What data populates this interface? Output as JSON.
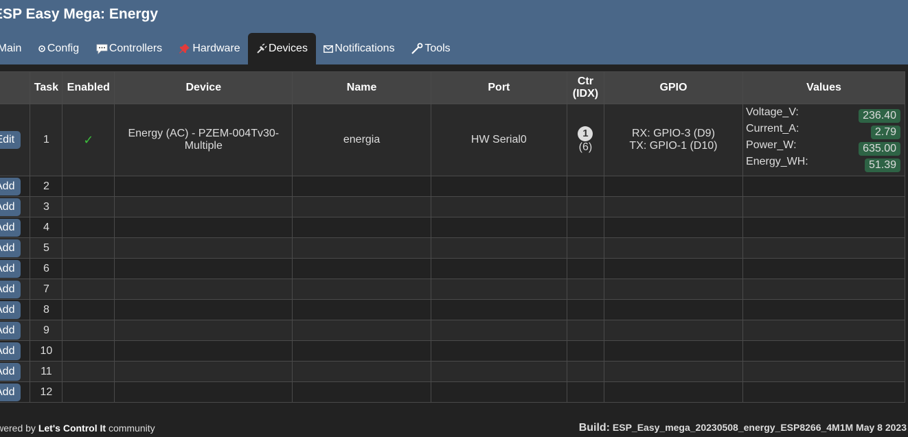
{
  "app": {
    "title": "ESP Easy Mega: Energy"
  },
  "menu": {
    "items": [
      {
        "id": "main",
        "label": "Main",
        "icon": "main-icon"
      },
      {
        "id": "config",
        "label": "Config",
        "icon": "gear-icon"
      },
      {
        "id": "controllers",
        "label": "Controllers",
        "icon": "speech-bubble-icon"
      },
      {
        "id": "hardware",
        "label": "Hardware",
        "icon": "pushpin-icon"
      },
      {
        "id": "devices",
        "label": "Devices",
        "icon": "plug-icon",
        "active": true
      },
      {
        "id": "notifications",
        "label": "Notifications",
        "icon": "envelope-icon"
      },
      {
        "id": "tools",
        "label": "Tools",
        "icon": "wrench-icon"
      }
    ]
  },
  "table": {
    "headers": [
      "",
      "Task",
      "Enabled",
      "Device",
      "Name",
      "Port",
      "Ctr (IDX)",
      "GPIO",
      "Values"
    ],
    "header_ctr_line1": "Ctr",
    "header_ctr_line2": "(IDX)",
    "first_row": {
      "button_label": "Edit",
      "task": "1",
      "enabled_mark": "✓",
      "device": "Energy (AC) - PZEM-004Tv30-Multiple",
      "name": "energia",
      "port": "HW Serial0",
      "ctr_number": "1",
      "ctr_idx": "(6)",
      "gpio_rx": "RX: GPIO-3 (D9)",
      "gpio_tx": "TX: GPIO-1 (D10)",
      "values": [
        {
          "name": "Voltage_V:",
          "value": "236.40"
        },
        {
          "name": "Current_A:",
          "value": "2.79"
        },
        {
          "name": "Power_W:",
          "value": "635.00"
        },
        {
          "name": "Energy_WH:",
          "value": "51.39"
        }
      ]
    },
    "empty_rows": [
      {
        "button_label": "Add",
        "task": "2"
      },
      {
        "button_label": "Add",
        "task": "3"
      },
      {
        "button_label": "Add",
        "task": "4"
      },
      {
        "button_label": "Add",
        "task": "5"
      },
      {
        "button_label": "Add",
        "task": "6"
      },
      {
        "button_label": "Add",
        "task": "7"
      },
      {
        "button_label": "Add",
        "task": "8"
      },
      {
        "button_label": "Add",
        "task": "9"
      },
      {
        "button_label": "Add",
        "task": "10"
      },
      {
        "button_label": "Add",
        "task": "11"
      },
      {
        "button_label": "Add",
        "task": "12"
      }
    ]
  },
  "footer": {
    "powered_prefix": "Powered by",
    "powered_name": "Let's Control It",
    "powered_suffix": "community",
    "build_label": "Build:",
    "build_value": "ESP_Easy_mega_20230508_energy_ESP8266_4M1M May 8 2023"
  },
  "colors": {
    "header_bg": "#4a6788",
    "page_bg": "#222222",
    "button_bg": "#4a6788",
    "value_box_bg": "#2e6345",
    "check": "#3bbd3b"
  }
}
